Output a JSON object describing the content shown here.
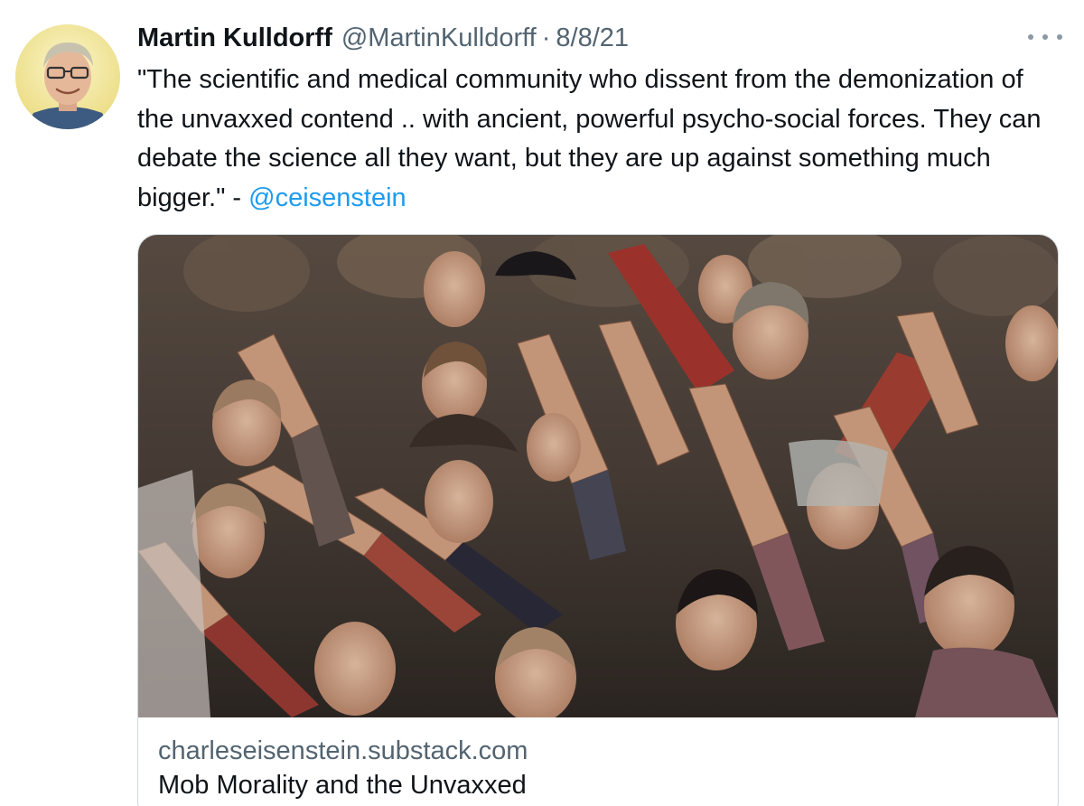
{
  "author": {
    "display_name": "Martin Kulldorff",
    "handle": "@MartinKulldorff",
    "separator": "·",
    "date": "8/8/21",
    "avatar_icon": "profile-photo"
  },
  "more_menu": {
    "icon": "more-horizontal-icon"
  },
  "tweet": {
    "text_quote": "\"The scientific and medical community who dissent from the demonization of the unvaxxed contend .. with ancient, powerful psycho-social forces. They can debate the science all they want, but they are up against something much bigger.\" - ",
    "mention": "@ceisenstein"
  },
  "link_card": {
    "domain": "charleseisenstein.substack.com",
    "title": "Mob Morality and the Unvaxxed",
    "image_icon": "historical-crowd-photo"
  },
  "colors": {
    "link": "#1d9bf0",
    "secondary_text": "#536471",
    "primary_text": "#0f1419",
    "border": "#cfd9de"
  }
}
